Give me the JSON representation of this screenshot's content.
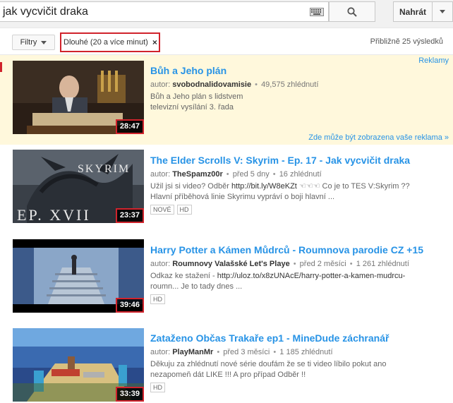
{
  "search": {
    "query": "jak vycvičit draka"
  },
  "header": {
    "upload_label": "Nahrát"
  },
  "filters": {
    "button_label": "Filtry",
    "active_chip": "Dlouhé (20 a více minut)",
    "chip_close": "×",
    "results_count": "Přibližně 25 výsledků"
  },
  "ads": {
    "label": "Reklamy",
    "note": "Zde může být zobrazena vaše reklama »"
  },
  "results": [
    {
      "title": "Bůh a Jeho plán",
      "author_prefix": "autor:",
      "author": "svobodnalidovamisie",
      "views": "49,575 zhlédnutí",
      "desc1": "Bůh a Jeho plán s lidstvem",
      "desc2": "televizní vysílání 3. řada",
      "duration": "28:47"
    },
    {
      "title": "The Elder Scrolls V: Skyrim - Ep. 17 - Jak vycvičit draka",
      "author_prefix": "autor:",
      "author": "TheSpamz00r",
      "age": "před 5 dny",
      "views": "16 zhlédnutí",
      "desc1_a": "Užil jsi si video? Odběr ",
      "desc1_link": "http://bit.ly/W8eKZt",
      "desc1_b": " ☜☜☜ Co je to TES V:Skyrim ??",
      "desc2": "Hlavní příběhová linie Skyrimu vypráví o boji hlavní ...",
      "badges": [
        "NOVÉ",
        "HD"
      ],
      "duration": "23:37",
      "thumb_text": "SKYRIM",
      "thumb_ep": "EP. XVII"
    },
    {
      "title": "Harry Potter a Kámen Můdrců - Roumnova parodie CZ +15",
      "author_prefix": "autor:",
      "author": "Roumnovy Valašské Let's Playe",
      "age": "před 2 měsíci",
      "views": "1 261 zhlédnutí",
      "desc1_a": "Odkaz ke stažení - ",
      "desc1_link": "http://uloz.to/x8zUNAcE/harry-potter-a-kamen-mudrcu-",
      "desc2": "roumn... Je to tady dnes ...",
      "badges": [
        "HD"
      ],
      "duration": "39:46"
    },
    {
      "title": "Zataženo Občas Trakaře ep1 - MineDude záchranář",
      "author_prefix": "autor:",
      "author": "PlayManMr",
      "age": "před 3 měsíci",
      "views": "1 185 zhlédnutí",
      "desc1": "Děkuju za zhlédnutí nové série doufám že se ti video líbilo pokut ano",
      "desc2": "nezapomeň dát LIKE !!! A pro případ Odběr !!",
      "badges": [
        "HD"
      ],
      "duration": "33:39"
    }
  ],
  "colors": {
    "link": "#2793e6",
    "highlight": "#d0232c",
    "ad_bg": "#fff8dc"
  }
}
